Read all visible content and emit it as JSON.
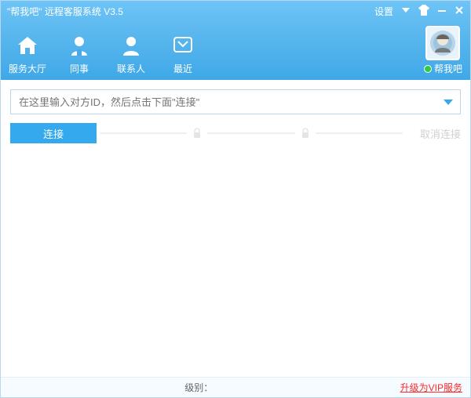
{
  "window": {
    "title": "\"帮我吧\" 远程客服系统 V3.5",
    "settings_label": "设置"
  },
  "nav": {
    "items": [
      {
        "label": "服务大厅",
        "icon": "home"
      },
      {
        "label": "同事",
        "icon": "colleague"
      },
      {
        "label": "联系人",
        "icon": "contact"
      },
      {
        "label": "最近",
        "icon": "recent"
      }
    ]
  },
  "user": {
    "name": "帮我吧",
    "status": "online"
  },
  "input": {
    "placeholder": "在这里输入对方ID，然后点击下面\"连接\""
  },
  "actions": {
    "connect": "连接",
    "cancel": "取消连接"
  },
  "footer": {
    "level_label": "级别：",
    "upgrade_label": "升级为VIP服务"
  },
  "colors": {
    "accent": "#35a9ee",
    "upgrade": "#ff2a2a"
  }
}
